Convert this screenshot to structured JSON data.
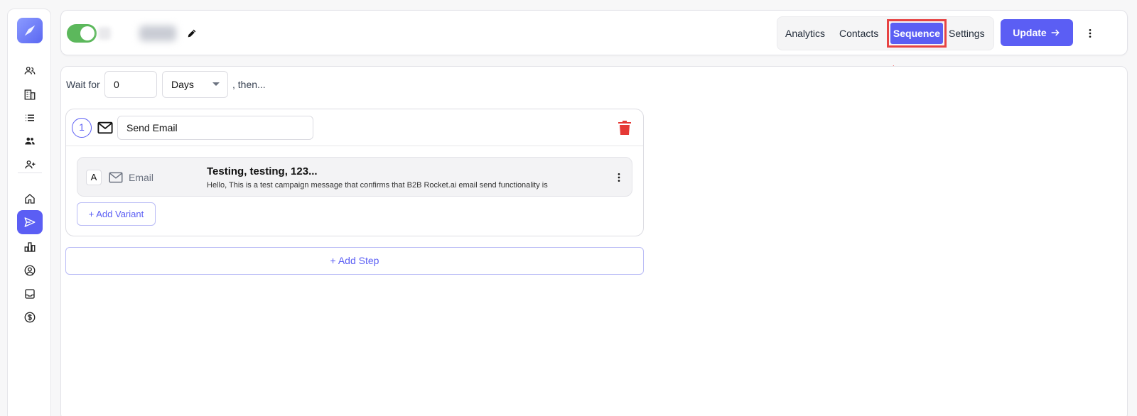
{
  "header": {
    "campaign_enabled": true,
    "tabs": [
      {
        "label": "Analytics"
      },
      {
        "label": "Contacts"
      },
      {
        "label": "Sequence",
        "active": true
      },
      {
        "label": "Settings"
      }
    ],
    "update_label": "Update",
    "accent_color": "#5b5ef4",
    "highlight_color": "#e74343"
  },
  "sidebar": {
    "icons": [
      "people-icon",
      "building-icon",
      "list-icon",
      "people-icon",
      "person-add-icon",
      "home-icon",
      "send-icon",
      "bar-chart-icon",
      "account-circle-icon",
      "inbox-icon",
      "dollar-icon"
    ],
    "active": "send-icon"
  },
  "sequence": {
    "wait_label": "Wait for",
    "wait_value": "0",
    "wait_unit": "Days",
    "then_label": ", then...",
    "steps": [
      {
        "number": "1",
        "name": "Send Email",
        "variants": [
          {
            "letter": "A",
            "type": "Email",
            "subject": "Testing, testing, 123...",
            "preview": "Hello, This is a test campaign message that confirms that B2B Rocket.ai email send functionality is"
          }
        ]
      }
    ],
    "add_variant_label": "+ Add Variant",
    "add_step_label": "+ Add Step"
  }
}
